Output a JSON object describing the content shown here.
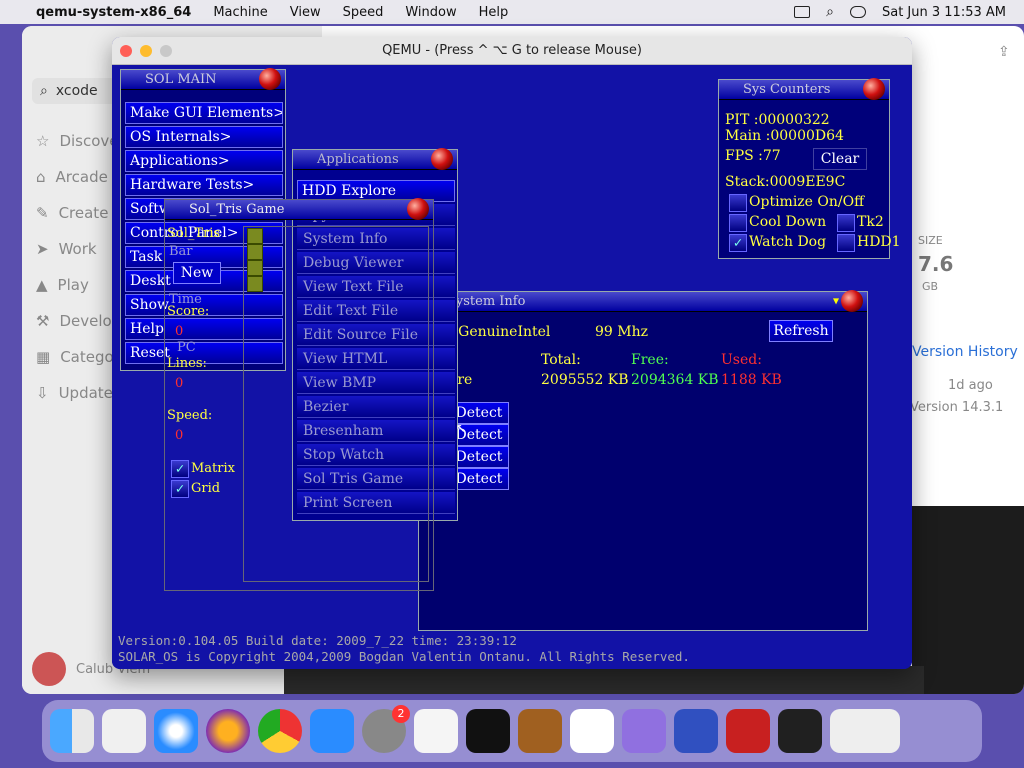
{
  "menubar": {
    "app": "qemu-system-x86_64",
    "items": [
      "Machine",
      "View",
      "Speed",
      "Window",
      "Help"
    ],
    "clock": "Sat Jun 3  11:53 AM"
  },
  "appstore": {
    "search": "xcode",
    "sidebar": [
      "Discover",
      "Arcade",
      "Create",
      "Work",
      "Play",
      "Develop",
      "Categories",
      "Updates"
    ],
    "user": "Calub Viem",
    "size_label": "SIZE",
    "size_value": "7.6",
    "size_unit": "GB",
    "history_link": "Version History",
    "ago": "1d ago",
    "version": "Version 14.3.1"
  },
  "qemu": {
    "title": "QEMU - (Press  ^ ⌥ G  to release Mouse)"
  },
  "sol_main": {
    "title": "SOL MAIN",
    "items": [
      "Make GUI Elements>",
      "OS Internals>",
      "Applications>",
      "Hardware Tests>",
      "Softw",
      "Control Panel>",
      "Task",
      "Deskt",
      "Show",
      "Help",
      "Reset"
    ]
  },
  "applications": {
    "title": "Applications",
    "items": [
      "HDD Explore",
      "Spy Windows",
      "System Info",
      "Debug Viewer",
      "View Text File",
      "Edit Text File",
      "Edit Source File",
      "View HTML",
      "View BMP",
      "Bezier",
      "Bresenham",
      "Stop Watch",
      "Sol Tris Game",
      "Print Screen"
    ]
  },
  "soltris": {
    "title": "Sol_Tris Game",
    "name": "Sol_Tris",
    "bar": "Bar",
    "new_btn": "New",
    "time": "Time",
    "score_label": "Score:",
    "score": "0",
    "pc": "PC",
    "lines_label": "Lines:",
    "lines": "0",
    "speed_label": "Speed:",
    "speed": "0",
    "matrix": "Matrix",
    "grid": "Grid"
  },
  "sys_counters": {
    "title": "Sys Counters",
    "pit": "PIT  :00000322",
    "main": "Main :00000D64",
    "fps": "FPS  :77",
    "clear": "Clear",
    "stack": "Stack:0009EE9C",
    "optimize": "Optimize On/Off",
    "cool": "Cool Down",
    "tk2": "Tk2",
    "watchdog": "Watch Dog",
    "hdd1": "HDD1"
  },
  "sys_info": {
    "title": "System Info",
    "cpu": ": GenuineIntel",
    "mhz": "99 Mhz",
    "refresh": "Refresh",
    "total": "Total:",
    "free": "Free:",
    "used": "Used:",
    "row_label": "are",
    "total_val": "2095552 KB",
    "free_val": "2094364 KB",
    "used_val": "1188 KB",
    "detect": [
      "Detect",
      "Detect",
      "Detect",
      "Detect"
    ]
  },
  "status": {
    "version": "Version:0.104.05  Build date: 2009_7_22  time: 23:39:12",
    "copyright": "SOLAR_OS is Copyright 2004,2009 Bogdan Valentin Ontanu. All Rights Reserved."
  },
  "dock": {
    "badge": "2"
  }
}
